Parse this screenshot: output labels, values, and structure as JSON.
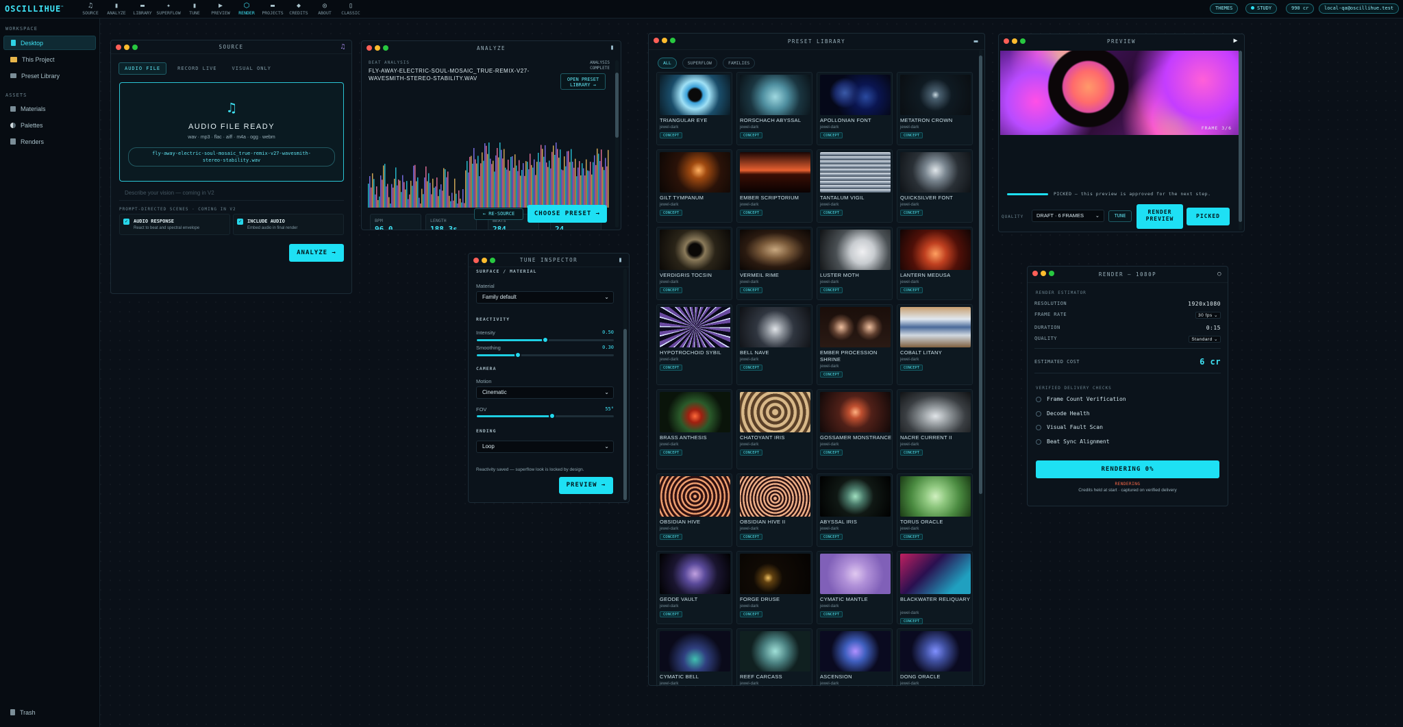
{
  "brand": {
    "logo": "OSCILLIHUE",
    "logo_mark": "™"
  },
  "nav": [
    {
      "label": "SOURCE",
      "icon": "♫"
    },
    {
      "label": "ANALYZE",
      "icon": "▮"
    },
    {
      "label": "LIBRARY",
      "icon": "▬"
    },
    {
      "label": "SUPERFLOW",
      "icon": "✦"
    },
    {
      "label": "TUNE",
      "icon": "▮"
    },
    {
      "label": "PREVIEW",
      "icon": "▶"
    },
    {
      "label": "RENDER",
      "icon": "⬡"
    },
    {
      "label": "PROJECTS",
      "icon": "▬"
    },
    {
      "label": "CREDITS",
      "icon": "◆"
    },
    {
      "label": "ABOUT",
      "icon": "◎"
    },
    {
      "label": "CLASSIC",
      "icon": "▯"
    }
  ],
  "top_right": {
    "themes": "THEMES",
    "study": "STUDY",
    "credits": "990 cr",
    "account": "local-qa@oscillihue.test"
  },
  "sidebar": {
    "workspace_title": "WORKSPACE",
    "workspace_items": [
      {
        "label": "Desktop"
      },
      {
        "label": "This Project"
      },
      {
        "label": "Preset Library"
      }
    ],
    "assets_title": "ASSETS",
    "asset_items": [
      {
        "label": "Materials"
      },
      {
        "label": "Palettes"
      },
      {
        "label": "Renders"
      }
    ],
    "trash": "Trash"
  },
  "source": {
    "title": "SOURCE",
    "tabs": [
      "AUDIO FILE",
      "RECORD LIVE",
      "VISUAL ONLY"
    ],
    "ready_title": "AUDIO FILE READY",
    "formats": "wav · mp3 · flac · aiff · m4a · ogg · webm",
    "filename": "fly-away-electric-soul-mosaic_true-remix-v27-wavesmith-stereo-stability.wav",
    "vision_placeholder": "Describe your vision — coming in V2",
    "prompt_note": "PROMPT-DIRECTED SCENES · COMING IN V2",
    "audio_response_title": "AUDIO RESPONSE",
    "audio_response_sub": "React to beat and spectral envelope",
    "include_audio_title": "INCLUDE AUDIO",
    "include_audio_sub": "Embed audio in final render",
    "analyze_btn": "ANALYZE →"
  },
  "analyze": {
    "title": "ANALYZE",
    "section": "BEAT ANALYSIS",
    "filename": "FLY-AWAY-ELECTRIC-SOUL-MOSAIC_TRUE-REMIX-V27-WAVESMITH-STEREO-STABILITY.WAV",
    "status_line1": "ANALYSIS",
    "status_line2": "COMPLETE",
    "open_library_1": "OPEN PRESET",
    "open_library_2": "LIBRARY →",
    "stats": [
      {
        "key": "BPM",
        "value": "96.0"
      },
      {
        "key": "LENGTH",
        "value": "188.3s"
      },
      {
        "key": "BEATS",
        "value": "284"
      },
      {
        "key": "FPS",
        "value": "24"
      }
    ],
    "resource_btn": "← RE-SOURCE",
    "choose_btn": "CHOOSE PRESET →"
  },
  "library": {
    "title": "PRESET LIBRARY",
    "filters": [
      "ALL",
      "SUPERFLOW",
      "FAMILIES"
    ],
    "tag": "CONCEPT",
    "family": "jewel-dark",
    "presets": [
      {
        "name": "TRIANGULAR EYE"
      },
      {
        "name": "RORSCHACH ABYSSAL"
      },
      {
        "name": "APOLLONIAN FONT"
      },
      {
        "name": "METATRON CROWN"
      },
      {
        "name": "GILT TYMPANUM"
      },
      {
        "name": "EMBER SCRIPTORIUM"
      },
      {
        "name": "TANTALUM VIGIL"
      },
      {
        "name": "QUICKSILVER FONT"
      },
      {
        "name": "VERDIGRIS TOCSIN"
      },
      {
        "name": "VERMEIL RIME"
      },
      {
        "name": "LUSTER MOTH"
      },
      {
        "name": "LANTERN MEDUSA"
      },
      {
        "name": "HYPOTROCHOID SYBIL"
      },
      {
        "name": "BELL NAVE"
      },
      {
        "name": "EMBER PROCESSION SHRINE"
      },
      {
        "name": "COBALT LITANY"
      },
      {
        "name": "BRASS ANTHESIS"
      },
      {
        "name": "CHATOYANT IRIS"
      },
      {
        "name": "GOSSAMER MONSTRANCE"
      },
      {
        "name": "NACRE CURRENT II"
      },
      {
        "name": "OBSIDIAN HIVE"
      },
      {
        "name": "OBSIDIAN HIVE II"
      },
      {
        "name": "ABYSSAL IRIS"
      },
      {
        "name": "TORUS ORACLE"
      },
      {
        "name": "GEODE VAULT"
      },
      {
        "name": "FORGE DRUSE"
      },
      {
        "name": "CYMATIC MANTLE"
      },
      {
        "name": "BLACKWATER RELIQUARY"
      },
      {
        "name": "CYMATIC BELL"
      },
      {
        "name": "REEF CARCASS"
      },
      {
        "name": "ASCENSION"
      },
      {
        "name": "DONG ORACLE"
      }
    ]
  },
  "tune": {
    "title": "TUNE INSPECTOR",
    "surface_header": "SURFACE / MATERIAL",
    "material_label": "Material",
    "material_value": "Family default",
    "reactivity_header": "REACTIVITY",
    "intensity_label": "Intensity",
    "intensity_value": "0.50",
    "intensity_level": 0.5,
    "smoothing_label": "Smoothing",
    "smoothing_value": "0.30",
    "smoothing_level": 0.3,
    "camera_header": "CAMERA",
    "motion_label": "Motion",
    "motion_value": "Cinematic",
    "fov_label": "FOV",
    "fov_value": "55°",
    "fov_level": 0.55,
    "ending_header": "ENDING",
    "ending_value": "Loop",
    "note": "Reactivity saved — superflow look is locked by design.",
    "preview_btn": "PREVIEW →"
  },
  "preview": {
    "title": "PREVIEW",
    "frame": "FRAME 3/6",
    "picked_text": "PICKED — this preview is approved for the next step.",
    "quality_label": "QUALITY",
    "quality_value": "DRAFT · 6 FRAMES",
    "tune_btn": "TUNE",
    "render_btn_1": "RENDER",
    "render_btn_2": "PREVIEW",
    "picked_btn": "PICKED"
  },
  "render": {
    "title": "RENDER — 1080P",
    "estimator": "RENDER ESTIMATOR",
    "resolution_label": "RESOLUTION",
    "resolution_value": "1920x1080",
    "frame_rate_label": "FRAME RATE",
    "frame_rate_value": "30 fps",
    "duration_label": "DURATION",
    "duration_value": "0:15",
    "quality_label": "QUALITY",
    "quality_value": "Standard",
    "cost_label": "ESTIMATED COST",
    "cost_value": "6 cr",
    "checks_title": "VERIFIED DELIVERY CHECKS",
    "checks": [
      "Frame Count Verification",
      "Decode Health",
      "Visual Fault Scan",
      "Beat Sync Alignment"
    ],
    "rendering_btn": "RENDERING 0%",
    "status": "RENDERING",
    "note": "Credits held at start · captured on verified delivery"
  }
}
